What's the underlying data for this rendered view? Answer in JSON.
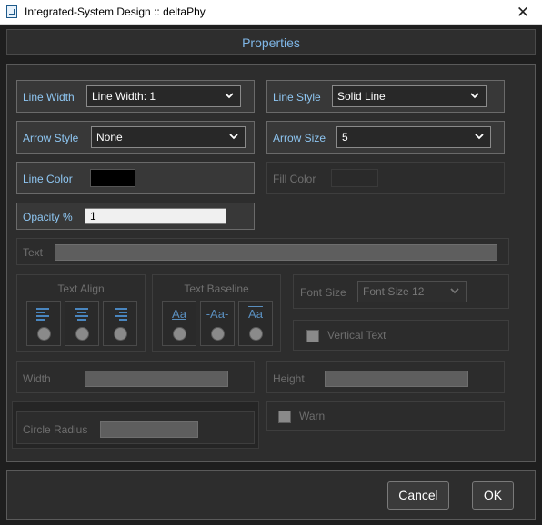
{
  "window": {
    "title": "Integrated-System Design :: deltaPhy",
    "close_glyph": "✕",
    "icon": "app-icon"
  },
  "header": {
    "title": "Properties"
  },
  "line_width": {
    "label": "Line Width",
    "value": "Line Width: 1"
  },
  "line_style": {
    "label": "Line Style",
    "value": "Solid Line"
  },
  "arrow_style": {
    "label": "Arrow Style",
    "value": "None"
  },
  "arrow_size": {
    "label": "Arrow Size",
    "value": "5"
  },
  "line_color": {
    "label": "Line Color",
    "color": "#000000"
  },
  "fill_color": {
    "label": "Fill Color"
  },
  "opacity": {
    "label": "Opacity %",
    "value": "1"
  },
  "text": {
    "label": "Text",
    "value": ""
  },
  "text_align": {
    "title": "Text Align",
    "options": [
      "align-left-icon",
      "align-center-icon",
      "align-right-icon"
    ]
  },
  "text_baseline": {
    "title": "Text Baseline",
    "options": [
      "Aa",
      "-Aa-",
      "Aa"
    ]
  },
  "font_size": {
    "label": "Font Size",
    "value": "Font Size 12"
  },
  "vertical_text": {
    "label": "Vertical Text",
    "checked": false
  },
  "width": {
    "label": "Width",
    "value": ""
  },
  "height": {
    "label": "Height",
    "value": ""
  },
  "circle_radius": {
    "label": "Circle Radius",
    "value": ""
  },
  "warn": {
    "label": "Warn",
    "checked": false
  },
  "buttons": {
    "cancel": "Cancel",
    "ok": "OK"
  },
  "colors": {
    "accent_label": "#8ec6f2",
    "header_title": "#7fb6e6",
    "panel": "#2d2d2d"
  }
}
